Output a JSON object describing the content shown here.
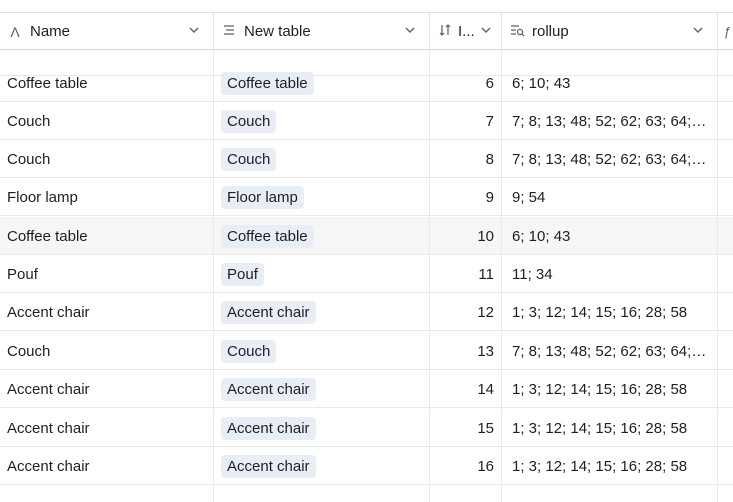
{
  "columns": [
    {
      "label": "Name",
      "icon": "text-a-icon"
    },
    {
      "label": "New table",
      "icon": "linked-record-icon"
    },
    {
      "label": "I...",
      "icon": "sort-number-icon"
    },
    {
      "label": "rollup",
      "icon": "rollup-icon"
    }
  ],
  "rows": [
    {
      "name": "Coffee table",
      "link": "Coffee table",
      "num": "6",
      "rollup": "6; 10; 43"
    },
    {
      "name": "Couch",
      "link": "Couch",
      "num": "7",
      "rollup": "7; 8; 13; 48; 52; 62; 63; 64; 6..."
    },
    {
      "name": "Couch",
      "link": "Couch",
      "num": "8",
      "rollup": "7; 8; 13; 48; 52; 62; 63; 64; 6..."
    },
    {
      "name": "Floor lamp",
      "link": "Floor lamp",
      "num": "9",
      "rollup": "9; 54"
    },
    {
      "name": "Coffee table",
      "link": "Coffee table",
      "num": "10",
      "rollup": "6; 10; 43"
    },
    {
      "name": "Pouf",
      "link": "Pouf",
      "num": "11",
      "rollup": "11; 34"
    },
    {
      "name": "Accent chair",
      "link": "Accent chair",
      "num": "12",
      "rollup": "1; 3; 12; 14; 15; 16; 28; 58"
    },
    {
      "name": "Couch",
      "link": "Couch",
      "num": "13",
      "rollup": "7; 8; 13; 48; 52; 62; 63; 64; 6..."
    },
    {
      "name": "Accent chair",
      "link": "Accent chair",
      "num": "14",
      "rollup": "1; 3; 12; 14; 15; 16; 28; 58"
    },
    {
      "name": "Accent chair",
      "link": "Accent chair",
      "num": "15",
      "rollup": "1; 3; 12; 14; 15; 16; 28; 58"
    },
    {
      "name": "Accent chair",
      "link": "Accent chair",
      "num": "16",
      "rollup": "1; 3; 12; 14; 15; 16; 28; 58"
    }
  ],
  "colors": {
    "chip_bg": "#e9edf6",
    "row_highlight": "#f6f6f7",
    "border": "#e8e9ec"
  }
}
